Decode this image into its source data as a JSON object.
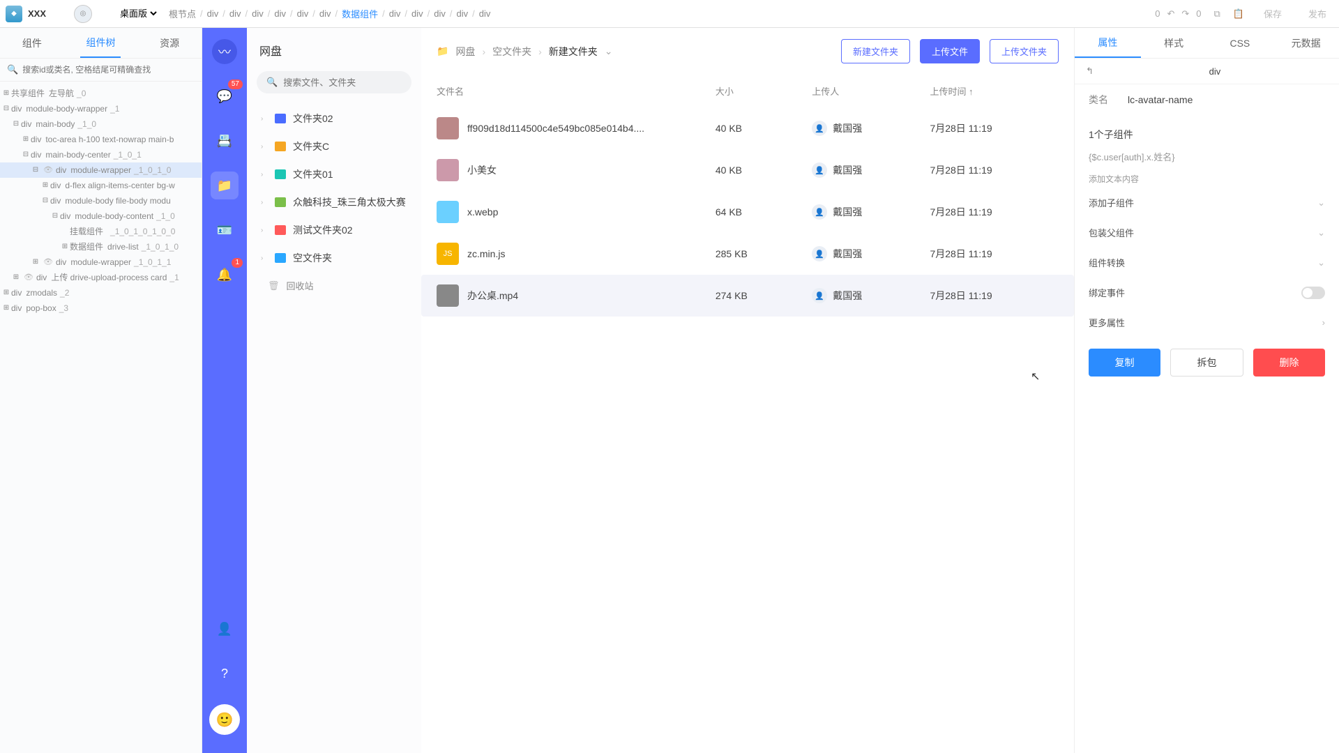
{
  "topbar": {
    "app_name": "XXX",
    "mode": "桌面版",
    "breadcrumb": [
      "根节点",
      "div",
      "div",
      "div",
      "div",
      "div",
      "div",
      "数据组件",
      "div",
      "div",
      "div",
      "div",
      "div"
    ],
    "undo_count": "0",
    "redo_count": "0",
    "save": "保存",
    "publish": "发布"
  },
  "left": {
    "tabs": [
      "组件",
      "组件树",
      "资源"
    ],
    "active_tab": 1,
    "search_placeholder": "搜索id或类名, 空格结尾可精确查找",
    "tree": [
      {
        "indent": 0,
        "tog": "⊞",
        "tag": "共享组件",
        "cls": "左导航",
        "sec": "_0"
      },
      {
        "indent": 0,
        "tog": "⊟",
        "tag": "div",
        "cls": "module-body-wrapper",
        "sec": "_1"
      },
      {
        "indent": 1,
        "tog": "⊟",
        "tag": "div",
        "cls": "main-body",
        "sec": "_1_0"
      },
      {
        "indent": 2,
        "tog": "⊞",
        "tag": "div",
        "cls": "toc-area h-100 text-nowrap main-b",
        "sec": ""
      },
      {
        "indent": 2,
        "tog": "⊟",
        "tag": "div",
        "cls": "main-body-center",
        "sec": "_1_0_1"
      },
      {
        "indent": 3,
        "tog": "⊟",
        "eye": true,
        "tag": "div",
        "cls": "module-wrapper",
        "sec": "_1_0_1_0",
        "sel": true
      },
      {
        "indent": 4,
        "tog": "⊞",
        "tag": "div",
        "cls": "d-flex align-items-center bg-w",
        "sec": ""
      },
      {
        "indent": 4,
        "tog": "⊟",
        "tag": "div",
        "cls": "module-body file-body modu",
        "sec": ""
      },
      {
        "indent": 5,
        "tog": "⊟",
        "tag": "div",
        "cls": "module-body-content",
        "sec": "_1_0"
      },
      {
        "indent": 6,
        "tog": "",
        "tag": "挂载组件",
        "cls": "",
        "sec": "_1_0_1_0_1_0_0"
      },
      {
        "indent": 6,
        "tog": "⊞",
        "tag": "数据组件",
        "cls": "drive-list",
        "sec": "_1_0_1_0"
      },
      {
        "indent": 3,
        "tog": "⊞",
        "eye": true,
        "tag": "div",
        "cls": "module-wrapper",
        "sec": "_1_0_1_1"
      },
      {
        "indent": 1,
        "tog": "⊞",
        "eye": true,
        "tag": "div",
        "cls": "上传 drive-upload-process card",
        "sec": "_1"
      },
      {
        "indent": 0,
        "tog": "⊞",
        "tag": "div",
        "cls": "zmodals",
        "sec": "_2"
      },
      {
        "indent": 0,
        "tog": "⊞",
        "tag": "div",
        "cls": "pop-box",
        "sec": "_3"
      }
    ]
  },
  "rail": {
    "items": [
      {
        "icon": "logo",
        "badge": ""
      },
      {
        "icon": "chat",
        "badge": "57"
      },
      {
        "icon": "contacts",
        "badge": ""
      },
      {
        "icon": "folder",
        "badge": "",
        "active": true
      },
      {
        "icon": "card",
        "badge": ""
      },
      {
        "icon": "bell",
        "badge": "1"
      }
    ],
    "bottom": [
      {
        "icon": "user",
        "badge": ""
      },
      {
        "icon": "help",
        "badge": ""
      }
    ]
  },
  "drive": {
    "title": "网盘",
    "search_placeholder": "搜索文件、文件夹",
    "folders": [
      {
        "name": "文件夹02",
        "color": "#4a6cff"
      },
      {
        "name": "文件夹C",
        "color": "#f5a623"
      },
      {
        "name": "文件夹01",
        "color": "#1bc6b4"
      },
      {
        "name": "众触科技_珠三角太极大赛",
        "color": "#7bbf4a"
      },
      {
        "name": "测试文件夹02",
        "color": "#ff5a5a"
      },
      {
        "name": "空文件夹",
        "color": "#2aa7ff"
      }
    ],
    "trash": "回收站",
    "path": [
      "网盘",
      "空文件夹",
      "新建文件夹"
    ],
    "btn_newfolder": "新建文件夹",
    "btn_upload": "上传文件",
    "btn_uploadfolder": "上传文件夹",
    "cols": {
      "name": "文件名",
      "size": "大小",
      "uploader": "上传人",
      "time": "上传时间 ↑"
    },
    "files": [
      {
        "name": "ff909d18d114500c4e549bc085e014b4....",
        "size": "40 KB",
        "uploader": "戴国强",
        "time": "7月28日 11:19",
        "thumb": "#b88"
      },
      {
        "name": "小美女",
        "size": "40 KB",
        "uploader": "戴国强",
        "time": "7月28日 11:19",
        "thumb": "#c9a"
      },
      {
        "name": "x.webp",
        "size": "64 KB",
        "uploader": "戴国强",
        "time": "7月28日 11:19",
        "thumb": "#6bd0ff"
      },
      {
        "name": "zc.min.js",
        "size": "285 KB",
        "uploader": "戴国强",
        "time": "7月28日 11:19",
        "thumb": "#f7b500",
        "label": "JS"
      },
      {
        "name": "办公桌.mp4",
        "size": "274 KB",
        "uploader": "戴国强",
        "time": "7月28日 11:19",
        "thumb": "#888",
        "hl": true
      }
    ]
  },
  "inspect": {
    "tabs": [
      "属性",
      "样式",
      "CSS",
      "元数据"
    ],
    "active_tab": 0,
    "sel_elem": "div",
    "class_label": "类名",
    "class_value": "lc-avatar-name",
    "child_count": "1个子组件",
    "expr": "{$c.user[auth].x.姓名}",
    "add_text_hint": "添加文本内容",
    "rows": [
      "添加子组件",
      "包装父组件",
      "组件转换"
    ],
    "bind_event": "绑定事件",
    "more_attr": "更多属性",
    "btn_copy": "复制",
    "btn_unpack": "拆包",
    "btn_delete": "删除"
  }
}
